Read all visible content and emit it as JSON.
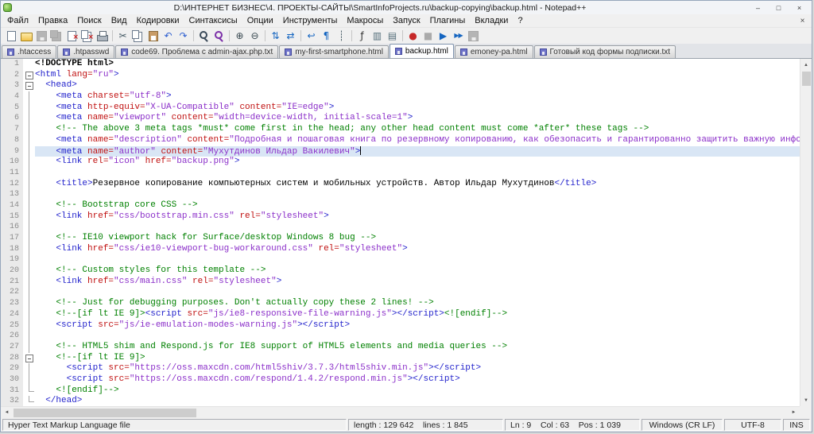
{
  "window": {
    "title": "D:\\ИНТЕРНЕТ БИЗНЕС\\4. ПРОЕКТЫ-САЙТЫ\\SmartInfoProjects.ru\\backup-copying\\backup.html - Notepad++",
    "controls": {
      "minimize": "–",
      "maximize": "□",
      "close": "×"
    }
  },
  "menu": {
    "close_glyph": "×",
    "items": [
      {
        "key": "file",
        "label": "Файл"
      },
      {
        "key": "edit",
        "label": "Правка"
      },
      {
        "key": "search",
        "label": "Поиск"
      },
      {
        "key": "view",
        "label": "Вид"
      },
      {
        "key": "encoding",
        "label": "Кодировки"
      },
      {
        "key": "language",
        "label": "Синтаксисы"
      },
      {
        "key": "settings",
        "label": "Опции"
      },
      {
        "key": "tools",
        "label": "Инструменты"
      },
      {
        "key": "macro",
        "label": "Макросы"
      },
      {
        "key": "run",
        "label": "Запуск"
      },
      {
        "key": "plugins",
        "label": "Плагины"
      },
      {
        "key": "tabs",
        "label": "Вкладки"
      },
      {
        "key": "help",
        "label": "?"
      }
    ]
  },
  "toolbar": {
    "icons": [
      {
        "name": "new-file-icon",
        "kind": "page"
      },
      {
        "name": "open-file-icon",
        "kind": "folder"
      },
      {
        "name": "save-icon",
        "kind": "floppy",
        "disabled": true
      },
      {
        "name": "save-all-icon",
        "kind": "floppy2",
        "disabled": true
      },
      {
        "name": "close-icon",
        "kind": "pagex"
      },
      {
        "name": "close-all-icon",
        "kind": "pagesx"
      },
      {
        "name": "print-icon",
        "kind": "printer"
      },
      {
        "name": "cut-icon",
        "kind": "glyph",
        "glyph": "✂",
        "color": "#455a64",
        "sep": true
      },
      {
        "name": "copy-icon",
        "kind": "copy"
      },
      {
        "name": "paste-icon",
        "kind": "paste"
      },
      {
        "name": "undo-icon",
        "kind": "glyph",
        "glyph": "↶",
        "color": "#2e5fd0"
      },
      {
        "name": "redo-icon",
        "kind": "glyph",
        "glyph": "↷",
        "color": "#2e5fd0"
      },
      {
        "name": "find-icon",
        "kind": "find",
        "sep": true
      },
      {
        "name": "replace-icon",
        "kind": "findrep"
      },
      {
        "name": "zoom-in-icon",
        "kind": "glyph",
        "glyph": "⊕",
        "color": "#37474f",
        "sep": true
      },
      {
        "name": "zoom-out-icon",
        "kind": "glyph",
        "glyph": "⊖",
        "color": "#37474f"
      },
      {
        "name": "sync-vertical-scroll-icon",
        "kind": "glyph",
        "glyph": "⇅",
        "color": "#1565c0",
        "sep": true
      },
      {
        "name": "sync-horizontal-scroll-icon",
        "kind": "glyph",
        "glyph": "⇄",
        "color": "#1565c0"
      },
      {
        "name": "word-wrap-icon",
        "kind": "glyph",
        "glyph": "↩",
        "color": "#1565c0",
        "sep": true
      },
      {
        "name": "show-all-characters-icon",
        "kind": "glyph",
        "glyph": "¶",
        "color": "#1565c0"
      },
      {
        "name": "indent-guide-icon",
        "kind": "glyph",
        "glyph": "┊",
        "color": "#455a64"
      },
      {
        "name": "function-list-icon",
        "kind": "glyph",
        "glyph": "ƒ",
        "color": "#333333",
        "sep": true
      },
      {
        "name": "document-map-icon",
        "kind": "glyph",
        "glyph": "▥",
        "color": "#546e7a"
      },
      {
        "name": "document-switcher-icon",
        "kind": "glyph",
        "glyph": "▤",
        "color": "#546e7a"
      },
      {
        "name": "record-macro-icon",
        "kind": "glyph",
        "glyph": "●",
        "color": "#c62828",
        "sep": true
      },
      {
        "name": "stop-record-icon",
        "kind": "glyph",
        "glyph": "■",
        "color": "#37474f",
        "disabled": true
      },
      {
        "name": "play-macro-icon",
        "kind": "glyph",
        "glyph": "▶",
        "color": "#1565c0"
      },
      {
        "name": "run-macro-multiple-icon",
        "kind": "glyph",
        "glyph": "▶▶",
        "color": "#1565c0"
      },
      {
        "name": "save-macro-icon",
        "kind": "floppy",
        "disabled": true
      }
    ]
  },
  "tabs": [
    {
      "key": "htaccess",
      "label": ".htaccess",
      "active": false
    },
    {
      "key": "htpasswd",
      "label": ".htpasswd",
      "active": false
    },
    {
      "key": "code69",
      "label": "code69. Проблема с admin-ajax.php.txt",
      "active": false
    },
    {
      "key": "my-first-smartphone",
      "label": "my-first-smartphone.html",
      "active": false
    },
    {
      "key": "backup",
      "label": "backup.html",
      "active": true
    },
    {
      "key": "emoney-pa",
      "label": "emoney-pa.html",
      "active": false
    },
    {
      "key": "subscription-form",
      "label": "Готовый код формы подписки.txt",
      "active": false
    }
  ],
  "editor": {
    "lines": [
      {
        "t": [
          [
            "d",
            "<!DOCTYPE html>"
          ]
        ]
      },
      {
        "f": "s",
        "t": [
          [
            "t",
            "<html "
          ],
          [
            "a",
            "lang="
          ],
          [
            "s",
            "\"ru\""
          ],
          [
            "t",
            ">"
          ]
        ]
      },
      {
        "f": "s",
        "t": [
          [
            "x",
            "  "
          ],
          [
            "t",
            "<head>"
          ]
        ]
      },
      {
        "f": "l",
        "t": [
          [
            "x",
            "    "
          ],
          [
            "t",
            "<meta "
          ],
          [
            "a",
            "charset="
          ],
          [
            "s",
            "\"utf-8\""
          ],
          [
            "t",
            ">"
          ]
        ]
      },
      {
        "f": "l",
        "t": [
          [
            "x",
            "    "
          ],
          [
            "t",
            "<meta "
          ],
          [
            "a",
            "http-equiv="
          ],
          [
            "s",
            "\"X-UA-Compatible\""
          ],
          [
            "a",
            " content="
          ],
          [
            "s",
            "\"IE=edge\""
          ],
          [
            "t",
            ">"
          ]
        ]
      },
      {
        "f": "l",
        "t": [
          [
            "x",
            "    "
          ],
          [
            "t",
            "<meta "
          ],
          [
            "a",
            "name="
          ],
          [
            "s",
            "\"viewport\""
          ],
          [
            "a",
            " content="
          ],
          [
            "s",
            "\"width=device-width, initial-scale=1\""
          ],
          [
            "t",
            ">"
          ]
        ]
      },
      {
        "f": "l",
        "t": [
          [
            "c",
            "    <!-- The above 3 meta tags *must* come first in the head; any other head content must come *after* these tags -->"
          ]
        ]
      },
      {
        "f": "l",
        "t": [
          [
            "x",
            "    "
          ],
          [
            "t",
            "<meta "
          ],
          [
            "a",
            "name="
          ],
          [
            "s",
            "\"description\""
          ],
          [
            "a",
            " content="
          ],
          [
            "s",
            "\"Подробная и пошаговая книга по резервному копированию, как обезопасить и гарантированно защитить важную информацию от внез"
          ]
        ]
      },
      {
        "f": "l",
        "cur": true,
        "caret": true,
        "t": [
          [
            "x",
            "    "
          ],
          [
            "t",
            "<meta "
          ],
          [
            "a",
            "name="
          ],
          [
            "s",
            "\"author\""
          ],
          [
            "a",
            " content="
          ],
          [
            "s",
            "\"Мухутдинов Ильдар Вакилевич\""
          ],
          [
            "t",
            ">"
          ]
        ]
      },
      {
        "f": "l",
        "t": [
          [
            "x",
            "    "
          ],
          [
            "t",
            "<link "
          ],
          [
            "a",
            "rel="
          ],
          [
            "s",
            "\"icon\""
          ],
          [
            "a",
            " href="
          ],
          [
            "s",
            "\"backup.png\""
          ],
          [
            "t",
            ">"
          ]
        ]
      },
      {
        "f": "l",
        "t": []
      },
      {
        "f": "l",
        "t": [
          [
            "x",
            "    "
          ],
          [
            "t",
            "<title>"
          ],
          [
            "x",
            "Резервное копирование компьютерных систем и мобильных устройств. Автор Ильдар Мухутдинов"
          ],
          [
            "t",
            "</title>"
          ]
        ]
      },
      {
        "f": "l",
        "t": []
      },
      {
        "f": "l",
        "t": [
          [
            "c",
            "    <!-- Bootstrap core CSS -->"
          ]
        ]
      },
      {
        "f": "l",
        "t": [
          [
            "x",
            "    "
          ],
          [
            "t",
            "<link "
          ],
          [
            "a",
            "href="
          ],
          [
            "s",
            "\"css/bootstrap.min.css\""
          ],
          [
            "a",
            " rel="
          ],
          [
            "s",
            "\"stylesheet\""
          ],
          [
            "t",
            ">"
          ]
        ]
      },
      {
        "f": "l",
        "t": []
      },
      {
        "f": "l",
        "t": [
          [
            "c",
            "    <!-- IE10 viewport hack for Surface/desktop Windows 8 bug -->"
          ]
        ]
      },
      {
        "f": "l",
        "t": [
          [
            "x",
            "    "
          ],
          [
            "t",
            "<link "
          ],
          [
            "a",
            "href="
          ],
          [
            "s",
            "\"css/ie10-viewport-bug-workaround.css\""
          ],
          [
            "a",
            " rel="
          ],
          [
            "s",
            "\"stylesheet\""
          ],
          [
            "t",
            ">"
          ]
        ]
      },
      {
        "f": "l",
        "t": []
      },
      {
        "f": "l",
        "t": [
          [
            "c",
            "    <!-- Custom styles for this template -->"
          ]
        ]
      },
      {
        "f": "l",
        "t": [
          [
            "x",
            "    "
          ],
          [
            "t",
            "<link "
          ],
          [
            "a",
            "href="
          ],
          [
            "s",
            "\"css/main.css\""
          ],
          [
            "a",
            " rel="
          ],
          [
            "s",
            "\"stylesheet\""
          ],
          [
            "t",
            ">"
          ]
        ]
      },
      {
        "f": "l",
        "t": []
      },
      {
        "f": "l",
        "t": [
          [
            "c",
            "    <!-- Just for debugging purposes. Don't actually copy these 2 lines! -->"
          ]
        ]
      },
      {
        "f": "l",
        "t": [
          [
            "c",
            "    <!--[if lt IE 9]>"
          ],
          [
            "t",
            "<script "
          ],
          [
            "a",
            "src="
          ],
          [
            "s",
            "\"js/ie8-responsive-file-warning.js\""
          ],
          [
            "t",
            "></script>"
          ],
          [
            "c",
            "<![endif]-->"
          ]
        ]
      },
      {
        "f": "l",
        "t": [
          [
            "x",
            "    "
          ],
          [
            "t",
            "<script "
          ],
          [
            "a",
            "src="
          ],
          [
            "s",
            "\"js/ie-emulation-modes-warning.js\""
          ],
          [
            "t",
            "></script>"
          ]
        ]
      },
      {
        "f": "l",
        "t": []
      },
      {
        "f": "l",
        "t": [
          [
            "c",
            "    <!-- HTML5 shim and Respond.js for IE8 support of HTML5 elements and media queries -->"
          ]
        ]
      },
      {
        "f": "s",
        "t": [
          [
            "c",
            "    <!--[if lt IE 9]>"
          ]
        ]
      },
      {
        "f": "l",
        "t": [
          [
            "x",
            "      "
          ],
          [
            "t",
            "<script "
          ],
          [
            "a",
            "src="
          ],
          [
            "s",
            "\"https://oss.maxcdn.com/html5shiv/3.7.3/html5shiv.min.js\""
          ],
          [
            "t",
            "></script>"
          ]
        ]
      },
      {
        "f": "l",
        "t": [
          [
            "x",
            "      "
          ],
          [
            "t",
            "<script "
          ],
          [
            "a",
            "src="
          ],
          [
            "s",
            "\"https://oss.maxcdn.com/respond/1.4.2/respond.min.js\""
          ],
          [
            "t",
            "></script>"
          ]
        ]
      },
      {
        "f": "e",
        "t": [
          [
            "c",
            "    <![endif]-->"
          ]
        ]
      },
      {
        "f": "e",
        "t": [
          [
            "x",
            "  "
          ],
          [
            "t",
            "</head>"
          ]
        ]
      }
    ]
  },
  "status": {
    "doc_type": "Hyper Text Markup Language file",
    "length_lines": "length : 129 642    lines : 1 845",
    "caret_position": "Ln : 9    Col : 63    Pos : 1 039",
    "eol_format": "Windows (CR LF)",
    "encoding": "UTF-8",
    "typing_mode": "INS"
  },
  "colors": {
    "tag": "#2222cc",
    "attr": "#c01010",
    "string": "#8b2fc9",
    "comment": "#008000",
    "text": "#000000",
    "doctype": "#000000",
    "current_line": "#d9e6f5"
  }
}
